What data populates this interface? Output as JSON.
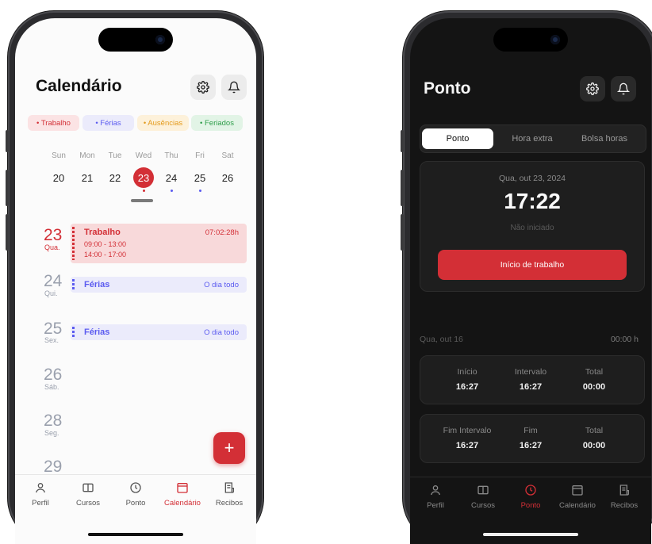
{
  "nav_items": [
    {
      "label": "Perfil",
      "icon": "profile-icon"
    },
    {
      "label": "Cursos",
      "icon": "book-icon"
    },
    {
      "label": "Ponto",
      "icon": "clock-icon"
    },
    {
      "label": "Calendário",
      "icon": "calendar-icon"
    },
    {
      "label": "Recibos",
      "icon": "receipt-icon"
    }
  ],
  "calendar_screen": {
    "title": "Calendário",
    "legend": [
      "• Trabalho",
      "• Férias",
      "• Ausências",
      "• Feriados"
    ],
    "weekdays": [
      "Sun",
      "Mon",
      "Tue",
      "Wed",
      "Thu",
      "Fri",
      "Sat"
    ],
    "week_days": [
      "20",
      "21",
      "22",
      "23",
      "24",
      "25",
      "26"
    ],
    "selected_day": "23",
    "agenda": [
      {
        "day": "23",
        "weekday": "Qua.",
        "title": "Trabalho",
        "right": "07:02:28h",
        "lines": [
          "09:00 - 13:00",
          "14:00 - 17:00"
        ]
      },
      {
        "day": "24",
        "weekday": "Qui.",
        "title": "Férias",
        "right": "O dia todo"
      },
      {
        "day": "25",
        "weekday": "Sex.",
        "title": "Férias",
        "right": "O dia todo"
      },
      {
        "day": "26",
        "weekday": "Sáb."
      },
      {
        "day": "28",
        "weekday": "Seg."
      },
      {
        "day": "29",
        "weekday": ""
      }
    ],
    "fab_label": "+",
    "active_nav": "Calendário"
  },
  "ponto_screen": {
    "title": "Ponto",
    "tabs": [
      "Ponto",
      "Hora extra",
      "Bolsa horas"
    ],
    "active_tab": "Ponto",
    "date": "Qua, out 23, 2024",
    "time": "17:22",
    "status": "Não iniciado",
    "start_button": "Início de trabalho",
    "history_date": "Qua, out 16",
    "history_total": "00:00 h",
    "row1": [
      {
        "label": "Início",
        "value": "16:27"
      },
      {
        "label": "Intervalo",
        "value": "16:27"
      },
      {
        "label": "Total",
        "value": "00:00"
      }
    ],
    "row2": [
      {
        "label": "Fim Intervalo",
        "value": "16:27"
      },
      {
        "label": "Fim",
        "value": "16:27"
      },
      {
        "label": "Total",
        "value": "00:00"
      }
    ],
    "active_nav": "Ponto"
  },
  "colors": {
    "accent_red": "#d32f36",
    "vacation_blue": "#5b5bf0",
    "absence_orange": "#f0a020",
    "holiday_green": "#2e9e4a"
  }
}
